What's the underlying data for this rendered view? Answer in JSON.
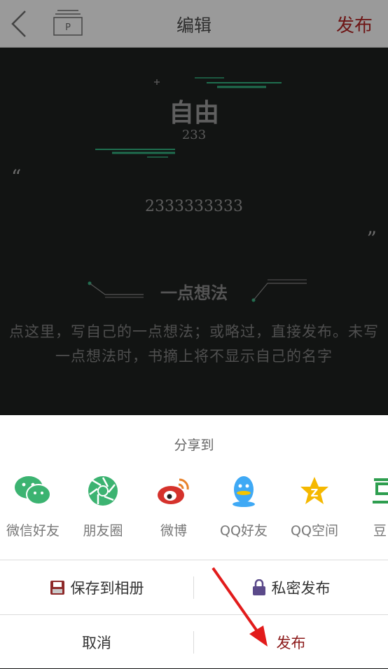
{
  "header": {
    "title": "编辑",
    "publish_label": "发布",
    "draft_icon_letter": "P"
  },
  "card": {
    "book_title": "自由",
    "author": "233",
    "quote_open": "“",
    "quote_close": "”",
    "excerpt": "2333333333",
    "thought_heading": "一点想法",
    "thought_placeholder": "点这里，写自己的一点想法；或略过，直接发布。未写一点想法时，书摘上将不显示自己的名字",
    "accent_color": "#1f6e4f"
  },
  "share": {
    "title": "分享到",
    "targets": [
      {
        "label": "微信好友",
        "icon": "wechat-icon",
        "color": "#3cb371"
      },
      {
        "label": "朋友圈",
        "icon": "moments-icon",
        "color": "#3cb371"
      },
      {
        "label": "微博",
        "icon": "weibo-icon",
        "color": "#d5322c"
      },
      {
        "label": "QQ好友",
        "icon": "qq-icon",
        "color": "#3fa9f5"
      },
      {
        "label": "QQ空间",
        "icon": "qzone-icon",
        "color": "#f5b800"
      },
      {
        "label": "豆",
        "icon": "douban-icon",
        "color": "#2e9e4f"
      }
    ]
  },
  "actions": {
    "save_to_album": "保存到相册",
    "private_publish": "私密发布",
    "cancel": "取消",
    "publish": "发布"
  }
}
